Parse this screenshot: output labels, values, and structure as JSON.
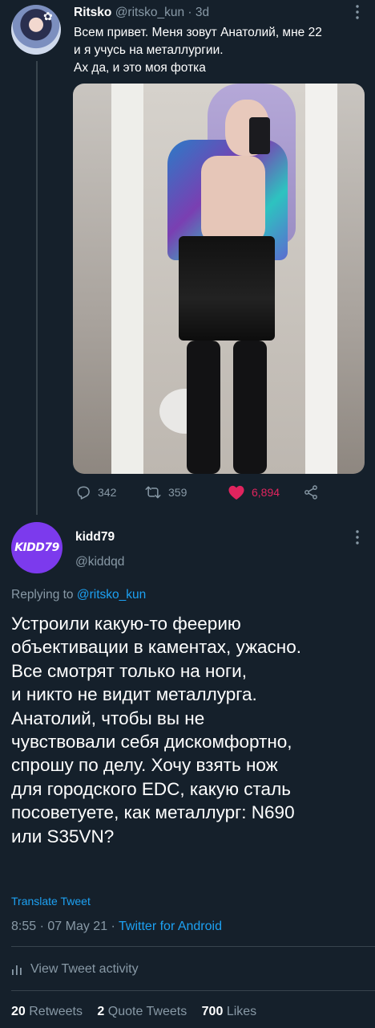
{
  "parent_tweet": {
    "name": "Ritsko",
    "handle": "@ritsko_kun",
    "time": "3d",
    "separator": "·",
    "text_lines": [
      "Всем привет. Меня зовут Анатолий, мне 22",
      "и я учусь на металлургии.",
      "Ах да, и это моя фотка"
    ],
    "reply_count": "342",
    "retweet_count": "359",
    "like_count": "6,894",
    "liked": true
  },
  "main_tweet": {
    "avatar_text": "KIDD79",
    "name": "kidd79",
    "handle": "@kiddqd",
    "replying_prefix": "Replying to",
    "replying_handle": "@ritsko_kun",
    "text_lines": [
      "Устроили какую-то феерию",
      "объективации в каментах, ужасно.",
      "Все смотрят только на ноги,",
      "и никто не видит металлурга.",
      "Анатолий, чтобы вы не",
      "чувствовали себя дискомфортно,",
      "спрошу по делу. Хочу взять нож",
      "для городского EDC, какую сталь",
      "посоветуете, как металлург: N690",
      "или S35VN?"
    ],
    "translate_label": "Translate Tweet",
    "time": "8:55",
    "date": "07 May 21",
    "separator": "·",
    "client": "Twitter for Android",
    "activity_label": "View Tweet activity",
    "retweets_count": "20",
    "retweets_label": "Retweets",
    "quotes_count": "2",
    "quotes_label": "Quote Tweets",
    "likes_count": "700",
    "likes_label": "Likes"
  },
  "colors": {
    "background": "#15202b",
    "accent": "#1da1f2",
    "muted": "#8899a6",
    "like": "#e0245e",
    "avatar_purple": "#7c3aed"
  }
}
